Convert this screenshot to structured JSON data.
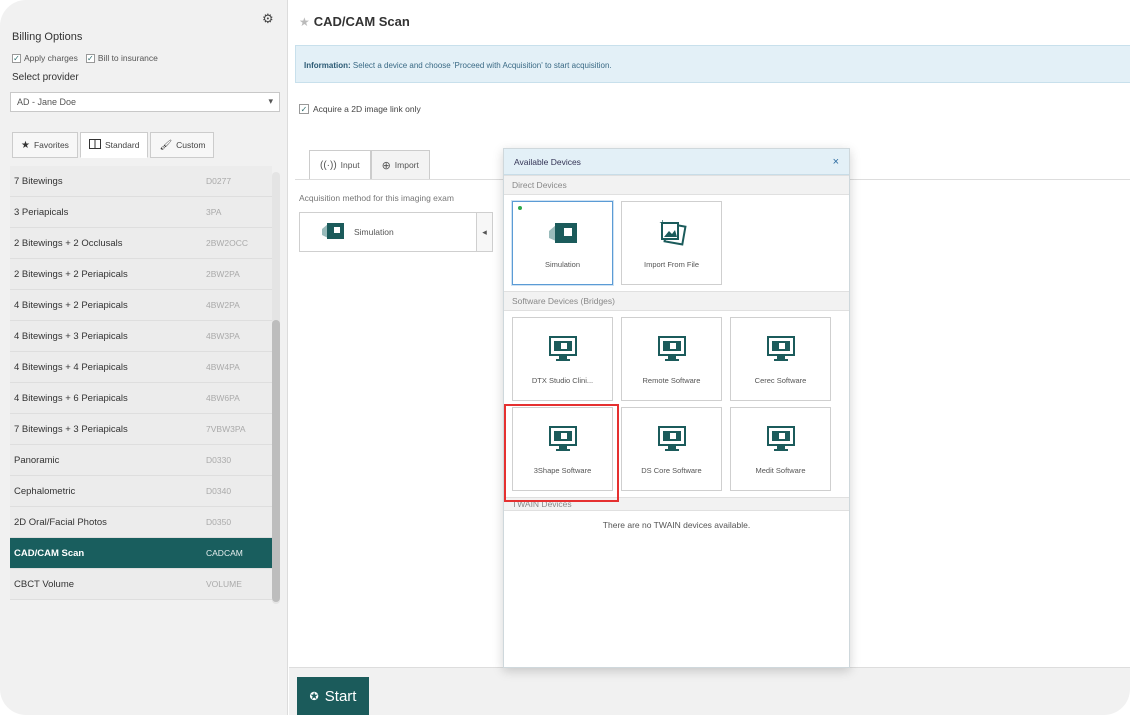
{
  "sidebar": {
    "billing_title": "Billing Options",
    "apply_charges": "Apply charges",
    "bill_insurance": "Bill to insurance",
    "provider_label": "Select provider",
    "provider_value": "AD - Jane Doe",
    "tabs": [
      {
        "label": "Favorites",
        "icon": "star-icon"
      },
      {
        "label": "Standard",
        "icon": "columns-icon"
      },
      {
        "label": "Custom",
        "icon": "brush-icon"
      }
    ],
    "rows": [
      {
        "name": "7 Bitewings",
        "code": "D0277"
      },
      {
        "name": "3 Periapicals",
        "code": "3PA"
      },
      {
        "name": "2 Bitewings + 2 Occlusals",
        "code": "2BW2OCC"
      },
      {
        "name": "2 Bitewings + 2 Periapicals",
        "code": "2BW2PA"
      },
      {
        "name": "4 Bitewings + 2 Periapicals",
        "code": "4BW2PA"
      },
      {
        "name": "4 Bitewings + 3 Periapicals",
        "code": "4BW3PA"
      },
      {
        "name": "4 Bitewings + 4 Periapicals",
        "code": "4BW4PA"
      },
      {
        "name": "4 Bitewings + 6 Periapicals",
        "code": "4BW6PA"
      },
      {
        "name": "7 Bitewings + 3 Periapicals",
        "code": "7VBW3PA"
      },
      {
        "name": "Panoramic",
        "code": "D0330"
      },
      {
        "name": "Cephalometric",
        "code": "D0340"
      },
      {
        "name": "2D Oral/Facial Photos",
        "code": "D0350"
      },
      {
        "name": "CAD/CAM Scan",
        "code": "CADCAM"
      },
      {
        "name": "CBCT Volume",
        "code": "VOLUME"
      }
    ]
  },
  "main": {
    "title": "CAD/CAM Scan",
    "info_bold": "Information:",
    "info_text": " Select a device and choose 'Proceed with Acquisition' to start acquisition.",
    "acquire_label": "Acquire a 2D image link only",
    "tabs": [
      {
        "label": "Input"
      },
      {
        "label": "Import"
      }
    ],
    "acq_method_label": "Acquisition method for this imaging exam",
    "selected_device": "Simulation",
    "start_label": "Start"
  },
  "popup": {
    "title": "Available Devices",
    "close": "×",
    "sections": {
      "direct": "Direct Devices",
      "software": "Software Devices (Bridges)",
      "twain": "TWAIN Devices"
    },
    "direct_devices": [
      "Simulation",
      "Import From File"
    ],
    "software_devices_row1": [
      "DTX Studio Clini...",
      "Remote Software",
      "Cerec Software"
    ],
    "software_devices_row2": [
      "3Shape Software",
      "DS Core Software",
      "Medit Software"
    ],
    "twain_empty": "There are no TWAIN devices available."
  },
  "colors": {
    "accent": "#195e5e",
    "info_bg": "#e3f0f7",
    "highlight": "#e53030"
  }
}
